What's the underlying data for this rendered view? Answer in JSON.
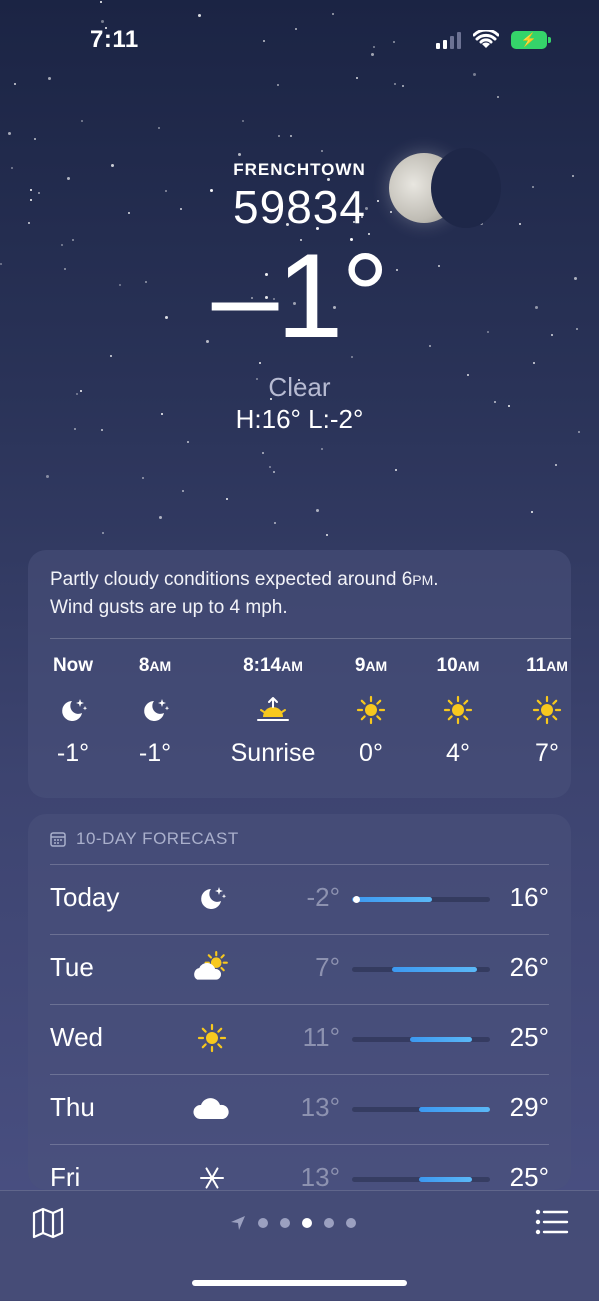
{
  "status": {
    "time": "7:11"
  },
  "location": {
    "name": "FRENCHTOWN",
    "zip": "59834"
  },
  "current": {
    "temperature": "–1°",
    "condition": "Clear",
    "hilo": "H:16°  L:-2°"
  },
  "summary": {
    "line1_pre": "Partly cloudy conditions expected around 6",
    "line1_unit": "PM",
    "line1_post": ".",
    "line2": "Wind gusts are up to 4 mph."
  },
  "hourly": [
    {
      "time": "Now",
      "suffix": "",
      "icon": "moon-stars-icon",
      "temp": "-1°"
    },
    {
      "time": "8",
      "suffix": "AM",
      "icon": "moon-stars-icon",
      "temp": "-1°"
    },
    {
      "time": "8:14",
      "suffix": "AM",
      "icon": "sunrise-icon",
      "temp": "Sunrise"
    },
    {
      "time": "9",
      "suffix": "AM",
      "icon": "sun-icon",
      "temp": "0°"
    },
    {
      "time": "10",
      "suffix": "AM",
      "icon": "sun-icon",
      "temp": "4°"
    },
    {
      "time": "11",
      "suffix": "AM",
      "icon": "sun-icon",
      "temp": "7°"
    }
  ],
  "forecast": {
    "title": "10-DAY FORECAST",
    "range": [
      -2,
      29
    ],
    "days": [
      {
        "day": "Today",
        "icon": "moon-stars-icon",
        "low": "-2°",
        "high": "16°",
        "low_val": -2,
        "high_val": 16,
        "current_val": -1
      },
      {
        "day": "Tue",
        "icon": "partly-cloudy-icon",
        "low": "7°",
        "high": "26°",
        "low_val": 7,
        "high_val": 26
      },
      {
        "day": "Wed",
        "icon": "sun-icon",
        "low": "11°",
        "high": "25°",
        "low_val": 11,
        "high_val": 25
      },
      {
        "day": "Thu",
        "icon": "cloud-icon",
        "low": "13°",
        "high": "29°",
        "low_val": 13,
        "high_val": 29
      },
      {
        "day": "Fri",
        "icon": "snow-icon",
        "low": "13°",
        "high": "25°",
        "low_val": 13,
        "high_val": 25
      }
    ]
  },
  "pager": {
    "count": 5,
    "active": 2
  },
  "colors": {
    "accent_bar": "#4aa8f4",
    "sun": "#f7c81e",
    "battery": "#35d46a"
  }
}
